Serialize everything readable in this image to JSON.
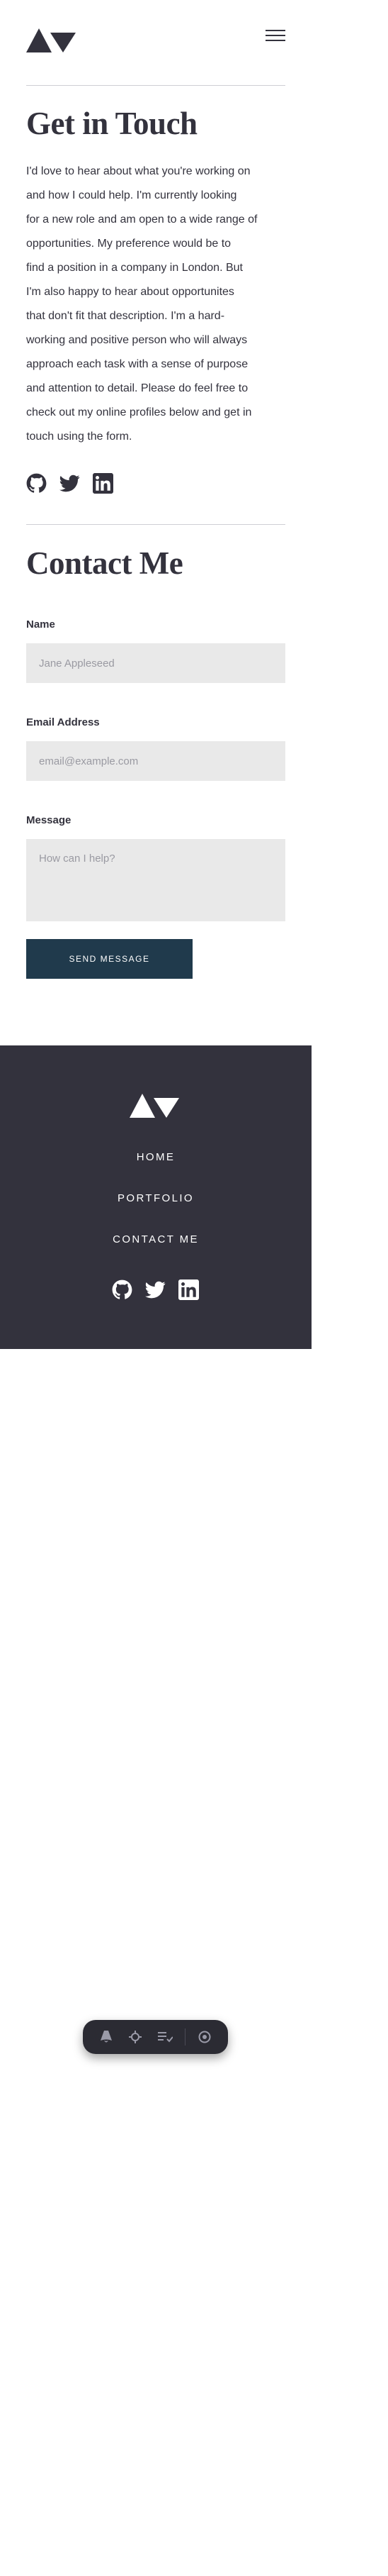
{
  "header": {
    "logo_alt": "AV",
    "menu_label": "Menu"
  },
  "about": {
    "title": "Get in Touch",
    "intro_lines": [
      "I'd love to hear about what you're working on",
      "and how I could help. I'm currently looking",
      "for a new role and am open to a wide range of",
      "opportunities. My preference would be to",
      "find a position in a company in London. But",
      "I'm also happy to hear about opportunites",
      "that don't fit that description. I'm a hard-",
      "working and positive person who will always",
      "approach each task with a sense of purpose",
      "and attention to detail. Please do feel free to",
      "check out my online profiles below and get in",
      "touch using the form."
    ],
    "social": [
      "github-icon",
      "twitter-icon",
      "linkedin-icon"
    ]
  },
  "contact": {
    "title": "Contact Me",
    "name_label": "Name",
    "name_placeholder": "Jane Appleseed",
    "email_label": "Email Address",
    "email_placeholder": "email@example.com",
    "message_label": "Message",
    "message_placeholder": "How can I help?",
    "send_label": "SEND MESSAGE"
  },
  "footer": {
    "nav": [
      "HOME",
      "PORTFOLIO",
      "CONTACT ME"
    ],
    "social": [
      "github-icon",
      "twitter-icon",
      "linkedin-icon"
    ]
  },
  "toolbar": {
    "items": [
      "astro-icon",
      "inspect-icon",
      "audit-icon",
      "settings-icon"
    ]
  },
  "colors": {
    "text": "#33323d",
    "footer_bg": "#33323d",
    "button_bg": "#203a4c",
    "input_bg": "#e9e9e9",
    "divider": "#cfcfd4"
  }
}
